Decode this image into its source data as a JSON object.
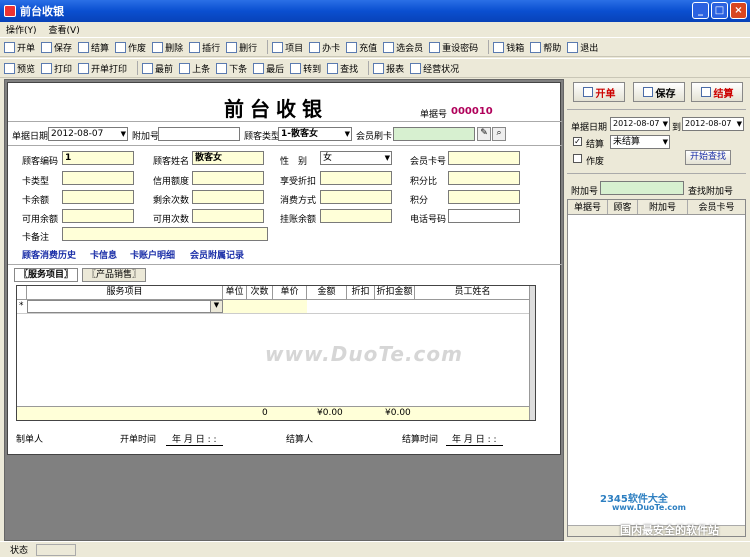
{
  "window": {
    "title": "前台收银"
  },
  "menu": [
    "操作(Y)",
    "查看(V)"
  ],
  "toolbar1": [
    {
      "icon": "new-icon",
      "label": "开单"
    },
    {
      "icon": "save-icon",
      "label": "保存"
    },
    {
      "icon": "checkout-icon",
      "label": "结算"
    },
    {
      "icon": "void-icon",
      "label": "作废"
    },
    {
      "icon": "delete-icon",
      "label": "删除"
    },
    {
      "icon": "insert-row-icon",
      "label": "插行"
    },
    {
      "icon": "delete-row-icon",
      "label": "删行"
    },
    {
      "icon": "item-icon",
      "label": "项目"
    },
    {
      "icon": "card-icon",
      "label": "办卡"
    },
    {
      "icon": "recharge-icon",
      "label": "充值"
    },
    {
      "icon": "select-member-icon",
      "label": "选会员"
    },
    {
      "icon": "reset-password-icon",
      "label": "重设密码"
    },
    {
      "icon": "cash-box-icon",
      "label": "钱箱"
    },
    {
      "icon": "help-icon",
      "label": "帮助"
    },
    {
      "icon": "exit-icon",
      "label": "退出"
    }
  ],
  "toolbar2": [
    {
      "icon": "preview-icon",
      "label": "预览"
    },
    {
      "icon": "print-icon",
      "label": "打印"
    },
    {
      "icon": "open-print-icon",
      "label": "开单打印"
    },
    {
      "icon": "first-icon",
      "label": "最前"
    },
    {
      "icon": "prev-icon",
      "label": "上条"
    },
    {
      "icon": "next-icon",
      "label": "下条"
    },
    {
      "icon": "last-icon",
      "label": "最后"
    },
    {
      "icon": "goto-icon",
      "label": "转到"
    },
    {
      "icon": "find-icon",
      "label": "查找"
    },
    {
      "icon": "report-icon",
      "label": "报表"
    },
    {
      "icon": "business-status-icon",
      "label": "经营状况"
    }
  ],
  "form": {
    "title": "前台收银",
    "bill_no_label": "单据号",
    "bill_no": "000010",
    "date_label": "单据日期",
    "date": "2012-08-07",
    "extra_no_label": "附加号",
    "extra_no": "",
    "cust_type_label": "顾客类型",
    "cust_type": "1-散客女",
    "member_card_label": "会员刷卡",
    "member_card": "",
    "cust_code_label": "顾客编码",
    "cust_code": "1",
    "cust_name_label": "顾客姓名",
    "cust_name": "散客女",
    "gender_label": "性　别",
    "gender": "女",
    "member_no_label": "会员卡号",
    "card_type_label": "卡类型",
    "credit_label": "信用额度",
    "discount_label": "享受折扣",
    "points_ratio_label": "积分比",
    "card_balance_label": "卡余额",
    "remaining_times_label": "剩余次数",
    "consume_mode_label": "消费方式",
    "points_label": "积分",
    "avail_balance_label": "可用余额",
    "avail_times_label": "可用次数",
    "on_account_label": "挂账余额",
    "phone_label": "电话号码",
    "card_note_label": "卡备注",
    "links": [
      "顾客消费历史",
      "卡信息",
      "卡账户明细",
      "会员附属记录"
    ],
    "tabs": [
      "〖服务项目〗",
      "〖产品销售〗"
    ],
    "grid_headers": [
      "服务项目",
      "单位",
      "次数",
      "单价",
      "金额",
      "折扣",
      "折扣金额",
      "员工姓名"
    ],
    "row_marker": "*",
    "totals": {
      "times": "0",
      "amount": "¥0.00",
      "disc_amount": "¥0.00"
    },
    "footer": {
      "maker_label": "制单人",
      "open_time_label": "开单时间",
      "open_time": "年 月 日 : :",
      "checkout_label": "结算人",
      "checkout_time_label": "结算时间",
      "checkout_time": "年 月 日 : :"
    }
  },
  "side": {
    "buttons": [
      "开单",
      "保存",
      "结算"
    ],
    "date_label": "单据日期",
    "date_from": "2012-08-07",
    "to_label": "到",
    "date_to": "2012-08-07",
    "checkout_check_label": "结算",
    "checkout_status": "未结算",
    "void_label": "作废",
    "search_button": "开始查找",
    "extra_label": "附加号",
    "find_extra_label": "查找附加号",
    "columns": [
      "单据号",
      "顾客",
      "附加号",
      "会员卡号"
    ]
  },
  "status": "状态",
  "watermark": "www.DuoTe.com",
  "watermark2": "2345软件大全",
  "watermark2_url": "www.DuoTe.com",
  "watermark3": "国内最安全的软件站"
}
